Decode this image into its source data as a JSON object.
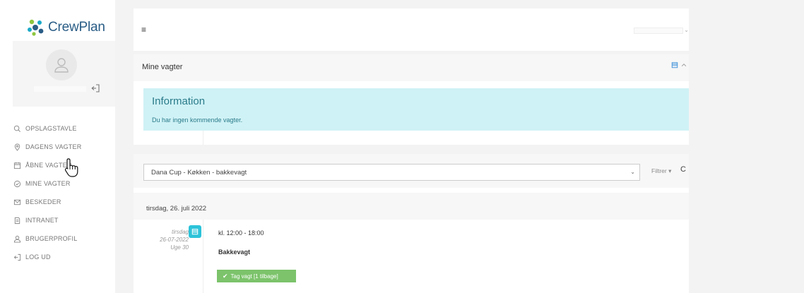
{
  "brand": {
    "name": "CrewPlan"
  },
  "sidebar": {
    "items": [
      {
        "label": "OPSLAGSTAVLE",
        "icon": "chat-icon"
      },
      {
        "label": "DAGENS VAGTER",
        "icon": "location-pin-icon"
      },
      {
        "label": "ÅBNE VAGTER",
        "icon": "calendar-icon"
      },
      {
        "label": "MINE VAGTER",
        "icon": "check-circle-icon"
      },
      {
        "label": "BESKEDER",
        "icon": "envelope-icon"
      },
      {
        "label": "INTRANET",
        "icon": "document-icon"
      },
      {
        "label": "BRUGERPROFIL",
        "icon": "user-icon"
      },
      {
        "label": "LOG UD",
        "icon": "logout-icon"
      }
    ]
  },
  "header": {
    "menu_icon": "≡"
  },
  "panel_my_shifts": {
    "title": "Mine vagter",
    "info_title": "Information",
    "info_text": "Du har ingen kommende vagter."
  },
  "shift_list": {
    "selected_filter": "Dana Cup - Køkken - bakkevagt",
    "filter_label": "Filtrer ▾",
    "refresh_icon": "C",
    "date_header": "tirsdag, 26. juli 2022",
    "events": [
      {
        "weekday": "tirsdag",
        "date": "26-07-2022",
        "week": "Uge 30",
        "time": "kl. 12:00 - 18:00",
        "name": "Bakkevagt",
        "action_label": "Tag vagt [1 tilbage]"
      }
    ]
  },
  "colors": {
    "info_bg": "#cff2f6",
    "badge": "#2dc3d9",
    "take_button": "#7cc36b",
    "brand_text": "#2a5d86"
  }
}
